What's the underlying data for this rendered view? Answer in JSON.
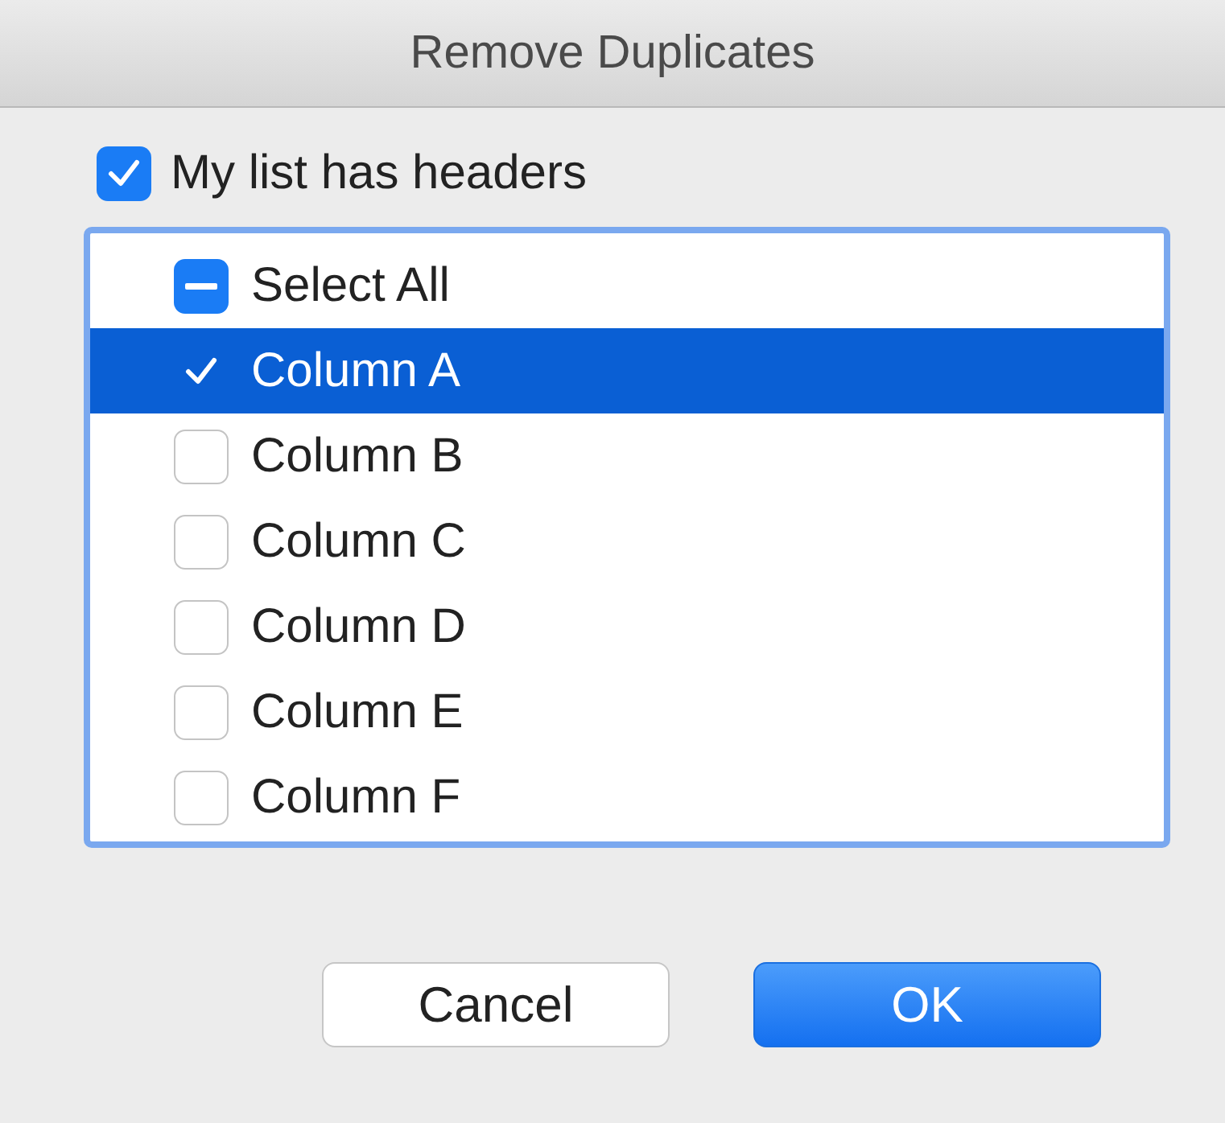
{
  "window": {
    "title": "Remove Duplicates"
  },
  "headers_option": {
    "label": "My list has headers",
    "checked": true
  },
  "select_all": {
    "label": "Select All",
    "mixed": true,
    "selected": false
  },
  "columns": [
    {
      "label": "Column A",
      "checked": true,
      "selected": true
    },
    {
      "label": "Column B",
      "checked": false,
      "selected": false
    },
    {
      "label": "Column C",
      "checked": false,
      "selected": false
    },
    {
      "label": "Column D",
      "checked": false,
      "selected": false
    },
    {
      "label": "Column E",
      "checked": false,
      "selected": false
    },
    {
      "label": "Column F",
      "checked": false,
      "selected": false
    }
  ],
  "buttons": [
    {
      "label": "Cancel",
      "default": false
    },
    {
      "label": "OK",
      "default": true
    }
  ]
}
